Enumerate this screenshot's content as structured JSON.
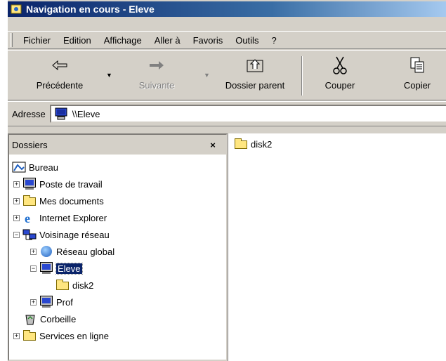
{
  "window": {
    "title": "Navigation en cours - Eleve"
  },
  "menu": [
    "Fichier",
    "Edition",
    "Affichage",
    "Aller à",
    "Favoris",
    "Outils",
    "?"
  ],
  "toolbar": {
    "back_label": "Précédente",
    "forward_label": "Suivante",
    "up_label": "Dossier parent",
    "cut_label": "Couper",
    "copy_label": "Copier"
  },
  "address": {
    "label": "Adresse",
    "value": "\\\\Eleve"
  },
  "folders_pane": {
    "title": "Dossiers",
    "close": "×",
    "tree": [
      {
        "label": "Bureau",
        "icon": "desktop-icon",
        "expander": ""
      },
      {
        "label": "Poste de travail",
        "icon": "computer-icon",
        "expander": "+"
      },
      {
        "label": "Mes documents",
        "icon": "folder-icon",
        "expander": "+"
      },
      {
        "label": "Internet Explorer",
        "icon": "internet-explorer-icon",
        "expander": "+"
      },
      {
        "label": "Voisinage réseau",
        "icon": "network-icon",
        "expander": "−"
      },
      {
        "label": "Réseau global",
        "icon": "globe-icon",
        "expander": "+"
      },
      {
        "label": "Eleve",
        "icon": "computer-icon",
        "expander": "−"
      },
      {
        "label": "disk2",
        "icon": "folder-icon",
        "expander": ""
      },
      {
        "label": "Prof",
        "icon": "computer-icon",
        "expander": "+"
      },
      {
        "label": "Corbeille",
        "icon": "recycle-bin-icon",
        "expander": ""
      },
      {
        "label": "Services en ligne",
        "icon": "folder-icon",
        "expander": "+"
      }
    ]
  },
  "content": {
    "items": [
      {
        "label": "disk2",
        "icon": "folder-icon"
      }
    ]
  },
  "colors": {
    "titlebar_start": "#0a246a",
    "titlebar_end": "#a6caf0",
    "selection": "#0a246a",
    "face": "#d4d0c8"
  }
}
